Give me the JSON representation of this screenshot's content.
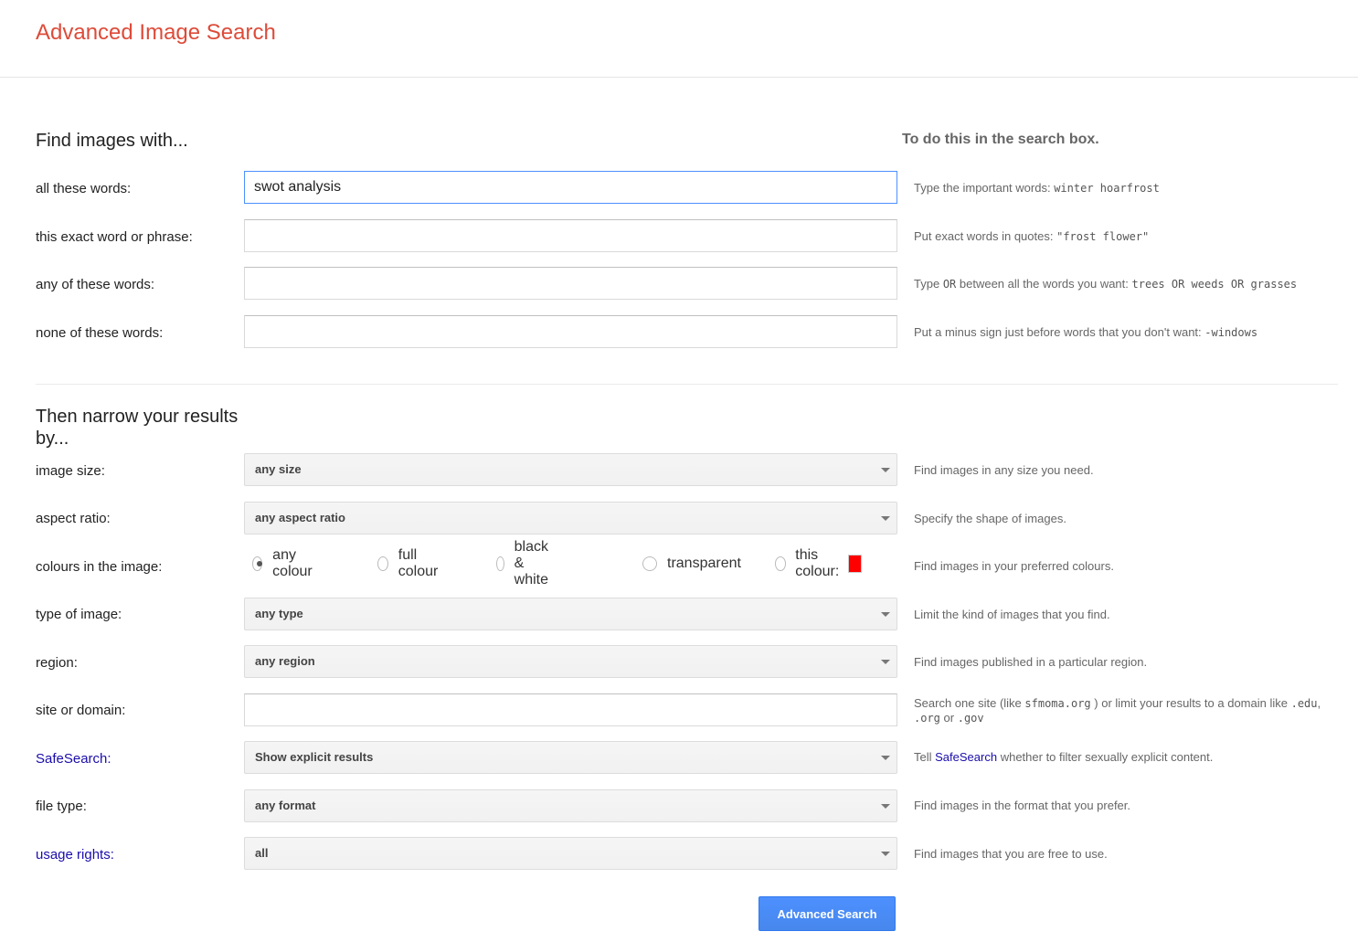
{
  "header": {
    "title": "Advanced Image Search"
  },
  "find_section": {
    "title": "Find images with...",
    "aside_title": "To do this in the search box.",
    "fields": [
      {
        "label": "all these words:",
        "value": "swot analysis",
        "placeholder": "",
        "hint_text": "Type the important words:",
        "hint_example": "winter hoarfrost"
      },
      {
        "label": "this exact word or phrase:",
        "value": "",
        "placeholder": "",
        "hint_text": "Put exact words in quotes:",
        "hint_example": "\"frost flower\""
      },
      {
        "label": "any of these words:",
        "value": "",
        "placeholder": "",
        "hint_text_before": "Type",
        "hint_or": "OR",
        "hint_text": "between all the words you want:",
        "hint_example": "trees OR weeds OR grasses"
      },
      {
        "label": "none of these words:",
        "value": "",
        "placeholder": "",
        "hint_text": "Put a minus sign just before words that you don't want:",
        "hint_example": "-windows"
      }
    ]
  },
  "narrow_section": {
    "title": "Then narrow your results by...",
    "image_size": {
      "label": "image size:",
      "value": "any size",
      "hint": "Find images in any size you need."
    },
    "aspect_ratio": {
      "label": "aspect ratio:",
      "value": "any aspect ratio",
      "hint": "Specify the shape of images."
    },
    "colours": {
      "label": "colours in the image:",
      "options": [
        "any colour",
        "full colour",
        "black & white",
        "transparent",
        "this colour:"
      ],
      "selected": "any colour",
      "swatch_color": "#ff0000",
      "hint": "Find images in your preferred colours."
    },
    "type_of_image": {
      "label": "type of image:",
      "value": "any type",
      "hint": "Limit the kind of images that you find."
    },
    "region": {
      "label": "region:",
      "value": "any region",
      "hint": "Find images published in a particular region."
    },
    "site_or_domain": {
      "label": "site or domain:",
      "value": "",
      "placeholder": "",
      "hint_1": "Search one site (like",
      "hint_code_1": "sfmoma.org",
      "hint_2": ") or limit your results to a domain like",
      "hint_code_2": ".edu",
      "hint_3": ",",
      "hint_code_3": ".org",
      "hint_4": "or",
      "hint_code_4": ".gov"
    },
    "safesearch": {
      "label": "SafeSearch",
      "label_suffix": ":",
      "value": "Show explicit results",
      "hint_before": "Tell",
      "hint_link": "SafeSearch",
      "hint_after": "whether to filter sexually explicit content."
    },
    "file_type": {
      "label": "file type:",
      "value": "any format",
      "hint": "Find images in the format that you prefer."
    },
    "usage_rights": {
      "label": "usage rights",
      "label_suffix": ":",
      "value": "all",
      "hint": "Find images that you are free to use."
    }
  },
  "submit": {
    "label": "Advanced Search"
  },
  "colors": {
    "title_red": "#dd4b39",
    "link_blue": "#1a0dab",
    "button_blue": "#4d90fe"
  }
}
